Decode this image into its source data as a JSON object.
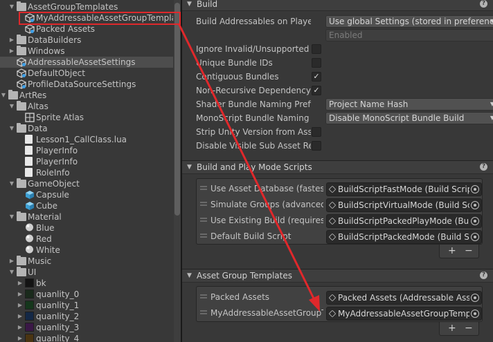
{
  "tree": [
    {
      "label": "AssetGroupTemplates",
      "depth": 1,
      "icon": "folder",
      "expanded": true
    },
    {
      "label": "MyAddressableAssetGroupTemplat",
      "depth": 2,
      "icon": "scriptable-object"
    },
    {
      "label": "Packed Assets",
      "depth": 2,
      "icon": "scriptable-object"
    },
    {
      "label": "DataBuilders",
      "depth": 1,
      "icon": "folder",
      "expanded": false
    },
    {
      "label": "Windows",
      "depth": 1,
      "icon": "folder",
      "expanded": false
    },
    {
      "label": "AddressableAssetSettings",
      "depth": 1,
      "icon": "scriptable-object",
      "selected": true
    },
    {
      "label": "DefaultObject",
      "depth": 1,
      "icon": "scriptable-object"
    },
    {
      "label": "ProfileDataSourceSettings",
      "depth": 1,
      "icon": "scriptable-object"
    },
    {
      "label": "ArtRes",
      "depth": 0,
      "icon": "folder",
      "expanded": true
    },
    {
      "label": "Altas",
      "depth": 1,
      "icon": "folder",
      "expanded": true
    },
    {
      "label": "Sprite Atlas",
      "depth": 2,
      "icon": "sprite-atlas"
    },
    {
      "label": "Data",
      "depth": 1,
      "icon": "folder",
      "expanded": true
    },
    {
      "label": "Lesson1_CallClass.lua",
      "depth": 2,
      "icon": "file"
    },
    {
      "label": "PlayerInfo",
      "depth": 2,
      "icon": "file"
    },
    {
      "label": "PlayerInfo",
      "depth": 2,
      "icon": "file"
    },
    {
      "label": "RoleInfo",
      "depth": 2,
      "icon": "file"
    },
    {
      "label": "GameObject",
      "depth": 1,
      "icon": "folder",
      "expanded": true
    },
    {
      "label": "Capsule",
      "depth": 2,
      "icon": "prefab"
    },
    {
      "label": "Cube",
      "depth": 2,
      "icon": "prefab"
    },
    {
      "label": "Material",
      "depth": 1,
      "icon": "folder",
      "expanded": true
    },
    {
      "label": "Blue",
      "depth": 2,
      "icon": "material"
    },
    {
      "label": "Red",
      "depth": 2,
      "icon": "material"
    },
    {
      "label": "White",
      "depth": 2,
      "icon": "material"
    },
    {
      "label": "Music",
      "depth": 1,
      "icon": "folder",
      "expanded": false
    },
    {
      "label": "UI",
      "depth": 1,
      "icon": "folder",
      "expanded": true
    },
    {
      "label": "bk",
      "depth": 2,
      "icon": "texture",
      "expandable": true,
      "color": "#141414"
    },
    {
      "label": "quanlity_0",
      "depth": 2,
      "icon": "texture",
      "expandable": true,
      "color": "#1a2a1c"
    },
    {
      "label": "quanlity_1",
      "depth": 2,
      "icon": "texture",
      "expandable": true,
      "color": "#15361c"
    },
    {
      "label": "quanlity_2",
      "depth": 2,
      "icon": "texture",
      "expandable": true,
      "color": "#142846"
    },
    {
      "label": "quanlity_3",
      "depth": 2,
      "icon": "texture",
      "expandable": true,
      "color": "#3a1846"
    },
    {
      "label": "quanlity_4",
      "depth": 2,
      "icon": "texture",
      "expandable": true,
      "color": "#4a3412"
    }
  ],
  "build": {
    "title": "Build",
    "props": [
      {
        "label": "Build Addressables on Player",
        "kind": "dropdown",
        "value": "Use global Settings (stored in preferences"
      },
      {
        "label": "",
        "kind": "readonly",
        "value": "Enabled"
      },
      {
        "label": "Ignore Invalid/Unsupported Fi",
        "kind": "checkbox",
        "checked": false
      },
      {
        "label": "Unique Bundle IDs",
        "kind": "checkbox",
        "checked": false
      },
      {
        "label": "Contiguous Bundles",
        "kind": "checkbox",
        "checked": true
      },
      {
        "label": "Non-Recursive Dependency C",
        "kind": "checkbox",
        "checked": true
      },
      {
        "label": "Shader Bundle Naming Prefix",
        "kind": "dropdown",
        "value": "Project Name Hash"
      },
      {
        "label": "MonoScript Bundle Naming P",
        "kind": "dropdown",
        "value": "Disable MonoScript Bundle Build"
      },
      {
        "label": "Strip Unity Version from Asset",
        "kind": "checkbox",
        "checked": false
      },
      {
        "label": "Disable Visible Sub Asset Rep",
        "kind": "checkbox",
        "checked": false
      }
    ]
  },
  "scripts": {
    "title": "Build and Play Mode Scripts",
    "rows": [
      {
        "label": "Use Asset Database (fastest)",
        "value": "BuildScriptFastMode (Build Script"
      },
      {
        "label": "Simulate Groups (advanced)",
        "value": "BuildScriptVirtualMode (Build Scri"
      },
      {
        "label": "Use Existing Build (requires bu",
        "value": "BuildScriptPackedPlayMode (Buil"
      },
      {
        "label": "Default Build Script",
        "value": "BuildScriptPackedMode (Build Sc"
      }
    ]
  },
  "templates": {
    "title": "Asset Group Templates",
    "rows": [
      {
        "label": "Packed Assets",
        "value": "Packed Assets (Addressable Asse"
      },
      {
        "label": "MyAddressableAssetGroupTe",
        "value": "MyAddressableAssetGroupTempla"
      }
    ]
  },
  "glyphs": {
    "help": "?",
    "add": "+",
    "remove": "−",
    "check": "✓",
    "expanded": "▼",
    "collapsed": "▶",
    "dropdown": "▼"
  },
  "colors": {
    "annotation": "#e0282b",
    "selection": "#4d4d4d",
    "panel": "#383838"
  }
}
